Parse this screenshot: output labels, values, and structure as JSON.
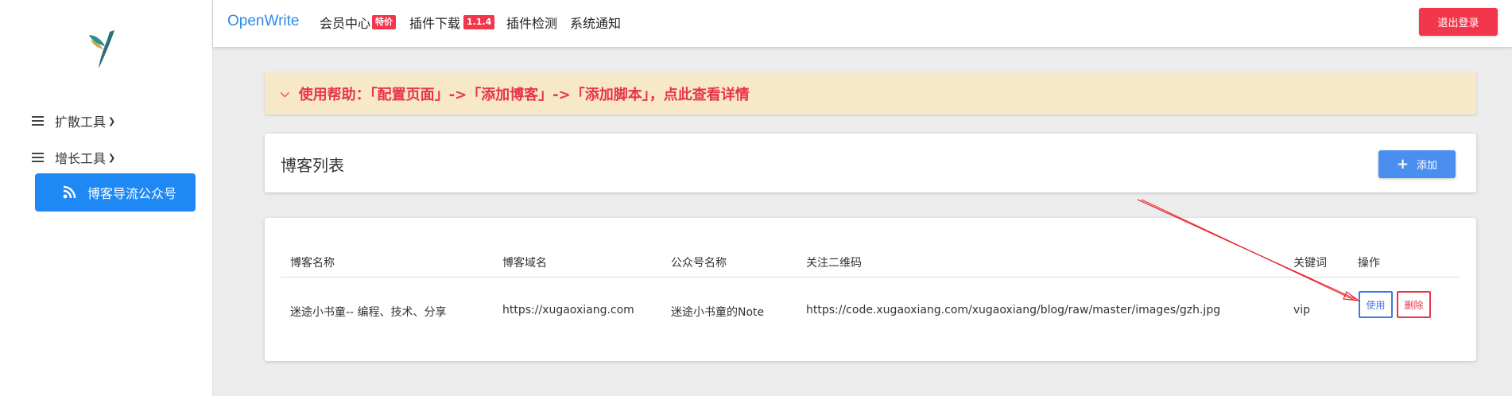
{
  "header": {
    "brand": "OpenWrite",
    "nav": [
      {
        "label": "会员中心",
        "badge": "特价"
      },
      {
        "label": "插件下载",
        "badge": "1.1.4"
      },
      {
        "label": "插件检测"
      },
      {
        "label": "系统通知"
      }
    ],
    "logout_label": "退出登录"
  },
  "sidebar": {
    "menus": [
      {
        "label": "扩散工具"
      },
      {
        "label": "增长工具"
      }
    ],
    "active_item": "博客导流公众号"
  },
  "help": {
    "text": "使用帮助：「配置页面」->「添加博客」->「添加脚本」，点此查看详情"
  },
  "blog_card": {
    "title": "博客列表",
    "add_label": "添加"
  },
  "table": {
    "headers": [
      "博客名称",
      "博客域名",
      "公众号名称",
      "关注二维码",
      "关键词",
      "操作"
    ],
    "rows": [
      {
        "name": "迷途小书童-- 编程、技术、分享",
        "domain": "https://xugaoxiang.com",
        "account": "迷途小书童的Note",
        "qrcode": "https://code.xugaoxiang.com/xugaoxiang/blog/raw/master/images/gzh.jpg",
        "keyword": "vip",
        "use_label": "使用",
        "delete_label": "删除"
      }
    ]
  },
  "colors": {
    "primary": "#1e88f5",
    "danger": "#f2374d",
    "brand": "#2d8ae8",
    "help_bg": "#f7e8c9",
    "annotation": "#e8202a"
  }
}
